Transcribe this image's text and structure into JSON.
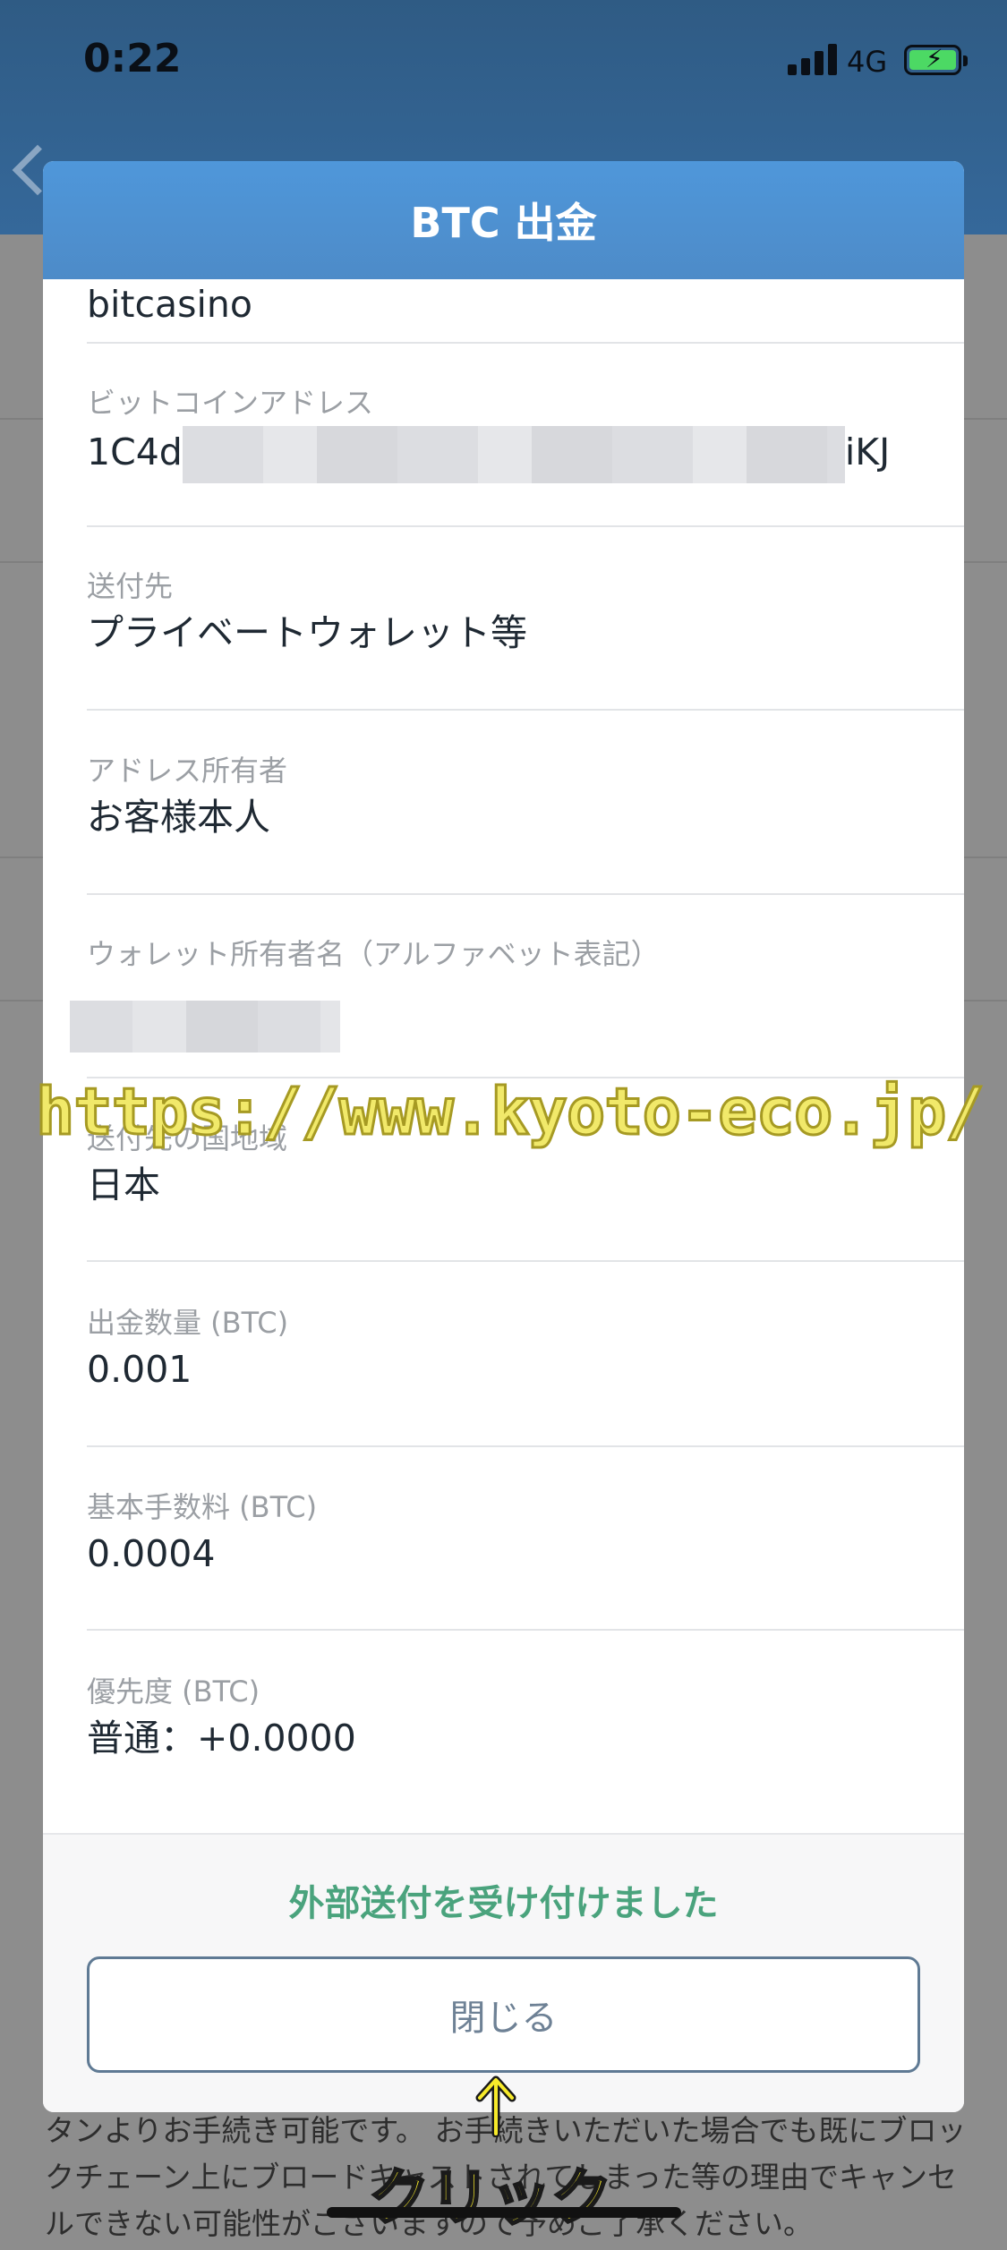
{
  "status_bar": {
    "time": "0:22",
    "network": "4G",
    "battery_icon": "battery-charging-icon",
    "signal_icon": "signal-bars-icon"
  },
  "modal": {
    "title": "BTC 出金",
    "fields": [
      {
        "label": "",
        "value": "bitcasino"
      },
      {
        "label": "ビットコインアドレス",
        "value_prefix": "1C4d",
        "value_suffix": "iKJ"
      },
      {
        "label": "送付先",
        "value": "プライベートウォレット等"
      },
      {
        "label": "アドレス所有者",
        "value": "お客様本人"
      },
      {
        "label": "ウォレット所有者名（アルファベット表記）",
        "value": ""
      },
      {
        "label": "送付先の国地域",
        "value": "日本"
      },
      {
        "label": "出金数量 (BTC)",
        "value": "0.001"
      },
      {
        "label": "基本手数料 (BTC)",
        "value": "0.0004"
      },
      {
        "label": "優先度 (BTC)",
        "value": "普通：+0.0000"
      }
    ],
    "status_message": "外部送付を受け付けました",
    "close_button": "閉じる"
  },
  "background": {
    "footer_text": "タンよりお手続き可能です。 お手続きいただいた場合でも既にブロックチェーン上にブロードキャストされてしまった等の理由でキャンセルできない可能性がございますので予めご了承ください。"
  },
  "overlay": {
    "watermark": "https://www.kyoto-eco.jp/",
    "click_label": "クリック"
  },
  "colors": {
    "header_blue": "#4f97da",
    "success_green": "#4aa37d",
    "button_border": "#5f7a94",
    "annotation_yellow": "#f7ea2a"
  }
}
